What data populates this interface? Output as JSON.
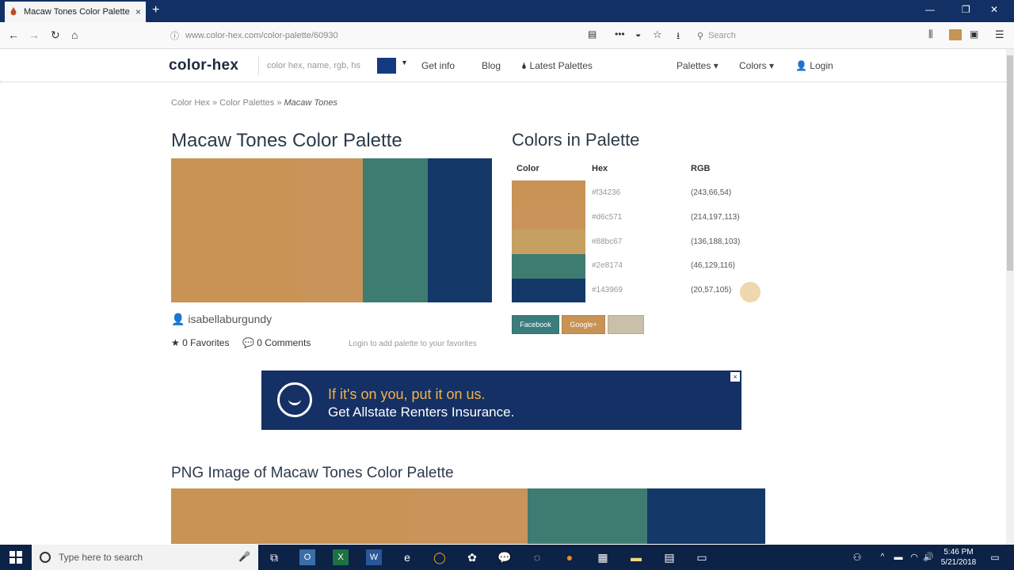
{
  "browser": {
    "tab_title": "Macaw Tones Color Palette",
    "tab_close": "×",
    "new_tab": "+",
    "url": "www.color-hex.com/color-palette/60930",
    "search_placeholder": "Search",
    "window_controls": [
      "—",
      "❐",
      "✕"
    ]
  },
  "site": {
    "logo": "color-hex",
    "search_placeholder": "color hex, name, rgb, hs",
    "get_info": "Get info",
    "nav": [
      "Blog",
      "Latest Palettes",
      "Palettes ▾",
      "Colors ▾",
      "Login"
    ],
    "accent": "#143a80"
  },
  "breadcrumb": {
    "items": [
      "Color Hex",
      "»",
      "Color Palettes",
      "»"
    ],
    "current": "Macaw Tones"
  },
  "palette": {
    "title": "Macaw Tones Color Palette",
    "author": "isabellaburgundy",
    "favorites": "0 Favorites",
    "comments": "0 Comments",
    "login_note": "Login to add palette to your favorites",
    "colors": [
      "#c89354",
      "#c8945a",
      "#3e7c72",
      "#143969"
    ]
  },
  "colors_in_palette": {
    "title": "Colors in Palette",
    "headers": [
      "Color",
      "Hex",
      "RGB"
    ],
    "rows": [
      {
        "swatch": "#c89354",
        "hex": "#f34236",
        "rgb": "(243,66,54)"
      },
      {
        "swatch": "#c8945a",
        "hex": "#d6c571",
        "rgb": "(214,197,113)"
      },
      {
        "swatch": "#c6a060",
        "hex": "#88bc67",
        "rgb": "(136,188,103)"
      },
      {
        "swatch": "#3e7c72",
        "hex": "#2e8174",
        "rgb": "(46,129,116)"
      },
      {
        "swatch": "#143969",
        "hex": "#143969",
        "rgb": "(20,57,105)"
      }
    ],
    "buttons": [
      {
        "label": "Facebook",
        "color": "#3b7c7c"
      },
      {
        "label": "Google+",
        "color": "#c89354"
      },
      {
        "label": "",
        "color": "#c8c0a8"
      }
    ]
  },
  "ad": {
    "line1": "If it's on you, put it on us.",
    "line2": "Get Allstate Renters Insurance.",
    "close": "×",
    "bg": "#143064"
  },
  "png_section": {
    "title": "PNG Image of Macaw Tones Color Palette"
  },
  "taskbar": {
    "search_placeholder": "Type here to search",
    "time": "5:46 PM",
    "date": "5/21/2018"
  }
}
